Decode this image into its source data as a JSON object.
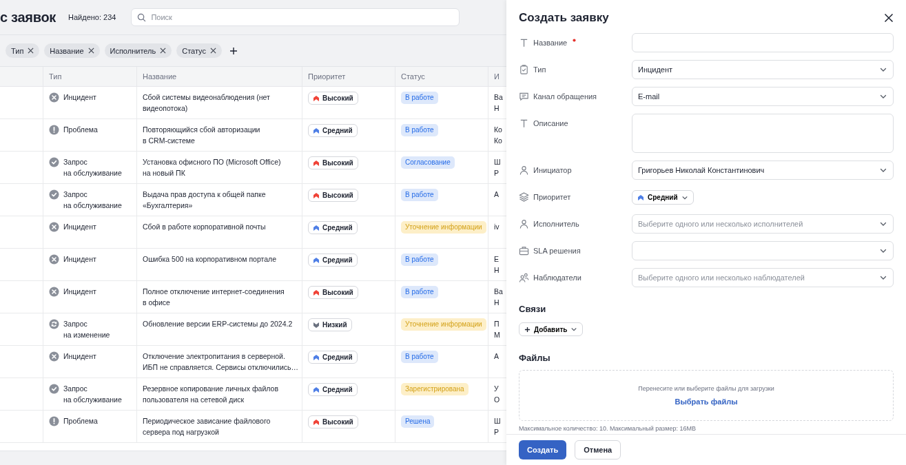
{
  "page": {
    "title": "с заявок",
    "found": "Найдено: 234",
    "search": {
      "placeholder": "Поиск"
    },
    "filters": [
      {
        "label": "Тип"
      },
      {
        "label": "Название"
      },
      {
        "label": "Исполнитель"
      },
      {
        "label": "Статус"
      }
    ],
    "table": {
      "columns": [
        "Тип",
        "Название",
        "Приоритет",
        "Статус",
        "И"
      ],
      "rows": [
        {
          "type": {
            "label": "Инцидент",
            "kind": "incident"
          },
          "title": "Сбой системы видеонаблюдения (нет\nвидеопотока)",
          "priority": {
            "label": "Высокий",
            "kind": "high"
          },
          "status": {
            "label": "В работе",
            "color": "#dde8fb"
          },
          "column_6": "Ва\nН"
        },
        {
          "type": {
            "label": "Проблема",
            "kind": "problem"
          },
          "title": "Повторяющийся сбой авторизации\nв CRM-системе",
          "priority": {
            "label": "Средний",
            "kind": "medium"
          },
          "status": {
            "label": "В работе",
            "color": "#dde8fb"
          },
          "column_6": "Ко\nКо"
        },
        {
          "type": {
            "label": "Запрос\nна обслуживание",
            "kind": "request"
          },
          "title": "Установка офисного ПО (Microsoft Office)\nна новый ПК",
          "priority": {
            "label": "Высокий",
            "kind": "high"
          },
          "status": {
            "label": "Согласование",
            "color": "#dde8fb"
          },
          "column_6": "Ш\nР"
        },
        {
          "type": {
            "label": "Запрос\nна обслуживание",
            "kind": "request"
          },
          "title": "Выдача прав доступа к общей папке\n«Бухгалтерия»",
          "priority": {
            "label": "Высокий",
            "kind": "high"
          },
          "status": {
            "label": "В работе",
            "color": "#dde8fb"
          },
          "column_6": "А"
        },
        {
          "type": {
            "label": "Инцидент",
            "kind": "incident"
          },
          "title": "Сбой в работе корпоративной почты",
          "priority": {
            "label": "Средний",
            "kind": "medium"
          },
          "status": {
            "label": "Уточнение информации",
            "color": "#fdefc8"
          },
          "column_6": "iv"
        },
        {
          "type": {
            "label": "Инцидент",
            "kind": "incident"
          },
          "title": "Ошибка 500 на корпоративном портале",
          "priority": {
            "label": "Средний",
            "kind": "medium"
          },
          "status": {
            "label": "В работе",
            "color": "#dde8fb"
          },
          "column_6": "Е\nН"
        },
        {
          "type": {
            "label": "Инцидент",
            "kind": "incident"
          },
          "title": "Полное отключение интернет-соединения\nв офисе",
          "priority": {
            "label": "Высокий",
            "kind": "high"
          },
          "status": {
            "label": "В работе",
            "color": "#dde8fb"
          },
          "column_6": "Ва\nН"
        },
        {
          "type": {
            "label": "Запрос\nна изменение",
            "kind": "change"
          },
          "title": "Обновление версии ERP-системы до 2024.2",
          "priority": {
            "label": "Низкий",
            "kind": "low"
          },
          "status": {
            "label": "Уточнение информации",
            "color": "#fdefc8"
          },
          "column_6": "П\nМ"
        },
        {
          "type": {
            "label": "Инцидент",
            "kind": "incident"
          },
          "title": "Отключение электропитания в серверной.\nИБП не справляется. Сервисы отключились…",
          "priority": {
            "label": "Средний",
            "kind": "medium"
          },
          "status": {
            "label": "В работе",
            "color": "#dde8fb"
          },
          "column_6": "А"
        },
        {
          "type": {
            "label": "Запрос\nна обслуживание",
            "kind": "request"
          },
          "title": "Резервное копирование личных файлов\nпользователя на сетевой диск",
          "priority": {
            "label": "Средний",
            "kind": "medium"
          },
          "status": {
            "label": "Зарегистрирована",
            "color": "#fdefc8"
          },
          "column_6": "У\nО"
        },
        {
          "type": {
            "label": "Проблема",
            "kind": "problem"
          },
          "title": "Периодическое зависание файлового\nсервера под нагрузкой",
          "priority": {
            "label": "Высокий",
            "kind": "high"
          },
          "status": {
            "label": "Решена",
            "color": "#dde8fb"
          },
          "column_6": "Ш\nР"
        }
      ]
    }
  },
  "form": {
    "title": "Создать заявку",
    "fields": [
      {
        "label": "Название",
        "required": true,
        "kind": "input"
      },
      {
        "label": "Тип",
        "required": false,
        "kind": "select",
        "value": "Инцидент"
      },
      {
        "label": "Канал обращения",
        "required": false,
        "kind": "select",
        "value": "E-mail"
      },
      {
        "label": "Описание",
        "required": false,
        "kind": "textarea"
      },
      {
        "label": "Инициатор",
        "required": false,
        "kind": "select",
        "value": "Григорьев Николай Константинович"
      },
      {
        "label": "Приоритет",
        "required": false,
        "kind": "priority",
        "priority": {
          "label": "Средний",
          "kind": "medium"
        }
      },
      {
        "label": "Исполнитель",
        "required": false,
        "kind": "select",
        "placeholder": "Выберите одного или несколько исполнителей"
      },
      {
        "label": "SLA решения",
        "required": false,
        "kind": "select"
      },
      {
        "label": "Наблюдатели",
        "required": false,
        "kind": "select",
        "placeholder": "Выберите одного или несколько наблюдателей"
      }
    ],
    "links": {
      "title": "Связи",
      "add_button": "Добавить"
    },
    "files": {
      "title": "Файлы",
      "hint": "Перенесите или выберите файлы для загрузки",
      "link": "Выбрать файлы",
      "note": "Максимальное количество: 10. Максимальный размер: 16MB"
    },
    "buttons": [
      {
        "label": "Создать",
        "kind": "primary"
      },
      {
        "label": "Отмена",
        "kind": "secondary"
      }
    ]
  }
}
